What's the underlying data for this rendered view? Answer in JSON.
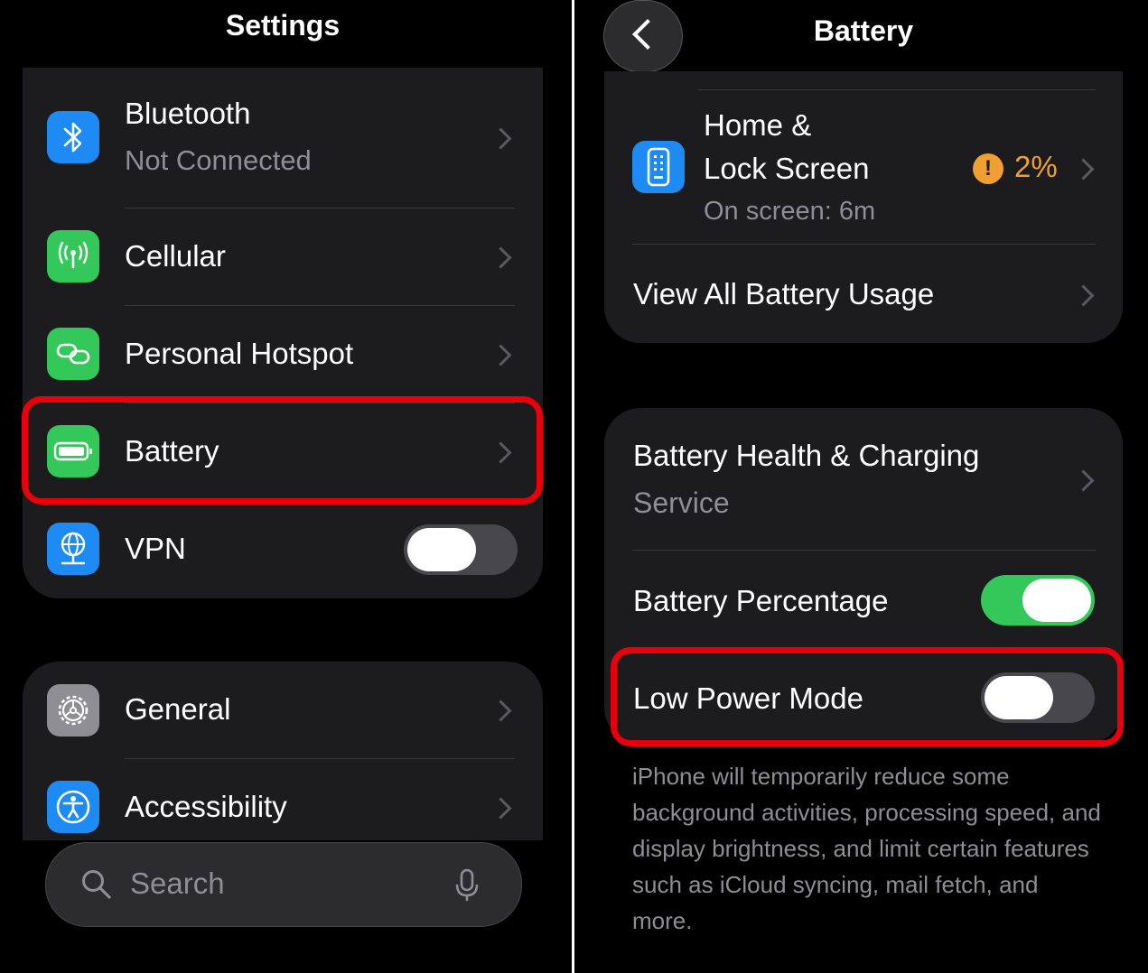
{
  "left": {
    "title": "Settings",
    "group1": {
      "bluetooth": {
        "label": "Bluetooth",
        "value": "Not Connected"
      },
      "cellular": {
        "label": "Cellular"
      },
      "hotspot": {
        "label": "Personal Hotspot"
      },
      "battery": {
        "label": "Battery"
      },
      "vpn": {
        "label": "VPN",
        "enabled": false
      }
    },
    "group2": {
      "general": {
        "label": "General"
      },
      "accessibility": {
        "label": "Accessibility"
      }
    },
    "search": {
      "placeholder": "Search"
    }
  },
  "right": {
    "title": "Battery",
    "usage": {
      "app_line1": "Home &",
      "app_line2": "Lock Screen",
      "app_detail": "On screen: 6m",
      "app_percent": "2%",
      "warning_glyph": "!",
      "view_all": "View All Battery Usage"
    },
    "settings": {
      "health_line1": "Battery Health & Charging",
      "health_line2": "Service",
      "percentage_label": "Battery Percentage",
      "percentage_enabled": true,
      "low_power_label": "Low Power Mode",
      "low_power_enabled": false
    },
    "footnote": "iPhone will temporarily reduce some background activities, processing speed, and display brightness, and limit certain features such as iCloud syncing, mail fetch, and more."
  },
  "colors": {
    "accent_blue": "#1e8bf5",
    "accent_green": "#34c759",
    "warning_orange": "#f0a030",
    "highlight_red": "#e8000c"
  }
}
